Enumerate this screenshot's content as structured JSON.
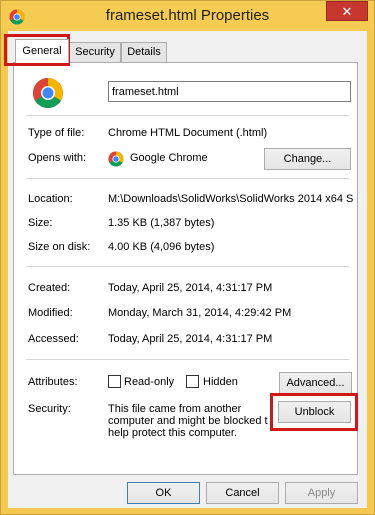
{
  "window": {
    "title": "frameset.html Properties",
    "close_label": "✕"
  },
  "tabs": [
    {
      "label": "General",
      "active": true
    },
    {
      "label": "Security",
      "active": false
    },
    {
      "label": "Details",
      "active": false
    }
  ],
  "general": {
    "file_name": "frameset.html",
    "type_of_file_label": "Type of file:",
    "type_of_file_value": "Chrome HTML Document (.html)",
    "opens_with_label": "Opens with:",
    "opens_with_value": "Google Chrome",
    "change_button": "Change...",
    "location_label": "Location:",
    "location_value": "M:\\Downloads\\SolidWorks\\SolidWorks 2014 x64 S",
    "size_label": "Size:",
    "size_value": "1.35 KB (1,387 bytes)",
    "size_on_disk_label": "Size on disk:",
    "size_on_disk_value": "4.00 KB (4,096 bytes)",
    "created_label": "Created:",
    "created_value": "Today, April 25, 2014, 4:31:17 PM",
    "modified_label": "Modified:",
    "modified_value": "Monday, March 31, 2014, 4:29:42 PM",
    "accessed_label": "Accessed:",
    "accessed_value": "Today, April 25, 2014, 4:31:17 PM",
    "attributes_label": "Attributes:",
    "readonly_label": "Read-only",
    "hidden_label": "Hidden",
    "advanced_button": "Advanced...",
    "security_label": "Security:",
    "security_line1": "This file came from another",
    "security_line2": "computer and might be blocked to",
    "security_line3": "help protect this computer.",
    "unblock_button": "Unblock"
  },
  "footer": {
    "ok": "OK",
    "cancel": "Cancel",
    "apply": "Apply"
  },
  "colors": {
    "title_bar": "#f6cb52",
    "close_button": "#c7372f",
    "highlight": "#d01818"
  },
  "icons": {
    "app": "chrome-icon",
    "file": "chrome-icon",
    "opens_with": "chrome-icon"
  }
}
